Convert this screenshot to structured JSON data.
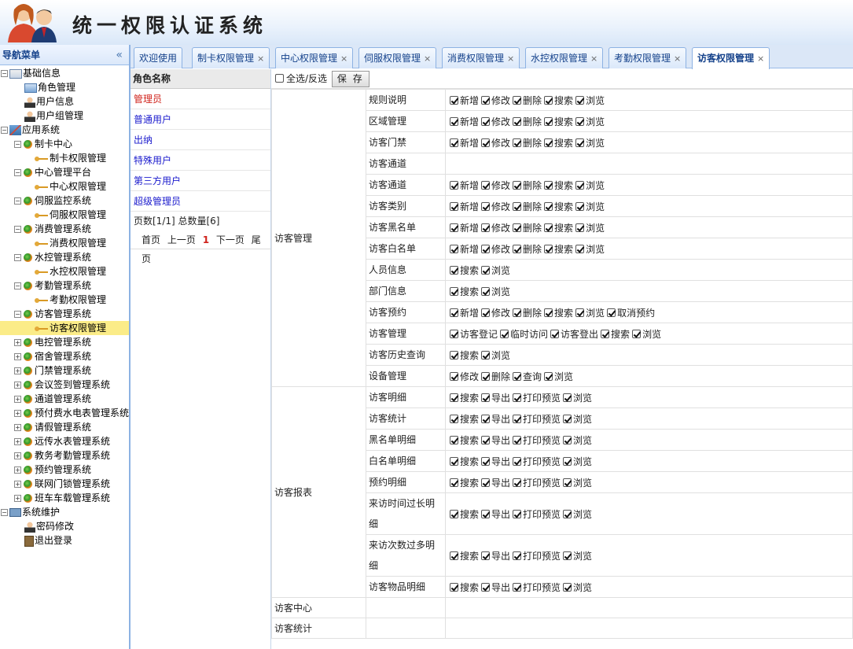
{
  "app": {
    "title": "统一权限认证系统"
  },
  "sidebar": {
    "title": "导航菜单",
    "collapse_glyph": "«",
    "items": [
      {
        "depth": 0,
        "exp": "-",
        "icon": "folder",
        "label": "基础信息"
      },
      {
        "depth": 1,
        "icon": "role",
        "label": "角色管理"
      },
      {
        "depth": 1,
        "icon": "user",
        "label": "用户信息"
      },
      {
        "depth": 1,
        "icon": "user",
        "label": "用户组管理"
      },
      {
        "depth": 0,
        "exp": "-",
        "icon": "house",
        "label": "应用系统"
      },
      {
        "depth": 1,
        "exp": "-",
        "icon": "globe",
        "label": "制卡中心"
      },
      {
        "depth": 2,
        "icon": "key",
        "label": "制卡权限管理"
      },
      {
        "depth": 1,
        "exp": "-",
        "icon": "globe",
        "label": "中心管理平台"
      },
      {
        "depth": 2,
        "icon": "key",
        "label": "中心权限管理"
      },
      {
        "depth": 1,
        "exp": "-",
        "icon": "globe",
        "label": "伺服监控系统"
      },
      {
        "depth": 2,
        "icon": "key",
        "label": "伺服权限管理"
      },
      {
        "depth": 1,
        "exp": "-",
        "icon": "globe",
        "label": "消费管理系统"
      },
      {
        "depth": 2,
        "icon": "key",
        "label": "消费权限管理"
      },
      {
        "depth": 1,
        "exp": "-",
        "icon": "globe",
        "label": "水控管理系统"
      },
      {
        "depth": 2,
        "icon": "key",
        "label": "水控权限管理"
      },
      {
        "depth": 1,
        "exp": "-",
        "icon": "globe",
        "label": "考勤管理系统"
      },
      {
        "depth": 2,
        "icon": "key",
        "label": "考勤权限管理"
      },
      {
        "depth": 1,
        "exp": "-",
        "icon": "globe",
        "label": "访客管理系统"
      },
      {
        "depth": 2,
        "icon": "key",
        "label": "访客权限管理",
        "selected": true
      },
      {
        "depth": 1,
        "exp": "+",
        "icon": "globe",
        "label": "电控管理系统"
      },
      {
        "depth": 1,
        "exp": "+",
        "icon": "globe",
        "label": "宿舍管理系统"
      },
      {
        "depth": 1,
        "exp": "+",
        "icon": "globe",
        "label": "门禁管理系统"
      },
      {
        "depth": 1,
        "exp": "+",
        "icon": "globe",
        "label": "会议签到管理系统"
      },
      {
        "depth": 1,
        "exp": "+",
        "icon": "globe",
        "label": "通道管理系统"
      },
      {
        "depth": 1,
        "exp": "+",
        "icon": "globe",
        "label": "预付费水电表管理系统"
      },
      {
        "depth": 1,
        "exp": "+",
        "icon": "globe",
        "label": "请假管理系统"
      },
      {
        "depth": 1,
        "exp": "+",
        "icon": "globe",
        "label": "远传水表管理系统"
      },
      {
        "depth": 1,
        "exp": "+",
        "icon": "globe",
        "label": "教务考勤管理系统"
      },
      {
        "depth": 1,
        "exp": "+",
        "icon": "globe",
        "label": "预约管理系统"
      },
      {
        "depth": 1,
        "exp": "+",
        "icon": "globe",
        "label": "联网门锁管理系统"
      },
      {
        "depth": 1,
        "exp": "+",
        "icon": "globe",
        "label": "班车车载管理系统"
      },
      {
        "depth": 0,
        "exp": "-",
        "icon": "pc",
        "label": "系统维护"
      },
      {
        "depth": 1,
        "icon": "user",
        "label": "密码修改"
      },
      {
        "depth": 1,
        "icon": "door",
        "label": "退出登录"
      }
    ]
  },
  "tabs": [
    {
      "label": "欢迎使用",
      "closable": false
    },
    {
      "label": "制卡权限管理",
      "closable": true
    },
    {
      "label": "中心权限管理",
      "closable": true
    },
    {
      "label": "伺服权限管理",
      "closable": true
    },
    {
      "label": "消费权限管理",
      "closable": true
    },
    {
      "label": "水控权限管理",
      "closable": true
    },
    {
      "label": "考勤权限管理",
      "closable": true
    },
    {
      "label": "访客权限管理",
      "closable": true,
      "active": true
    }
  ],
  "tab_close_glyph": "×",
  "roles": {
    "header": "角色名称",
    "items": [
      {
        "label": "管理员",
        "selected": true
      },
      {
        "label": "普通用户"
      },
      {
        "label": "出纳"
      },
      {
        "label": "特殊用户"
      },
      {
        "label": "第三方用户"
      },
      {
        "label": "超级管理员"
      }
    ],
    "page_info": "页数[1/1]  总数量[6]",
    "pager": {
      "first": "首页",
      "prev": "上一页",
      "current": "1",
      "next": "下一页",
      "last": "尾页"
    }
  },
  "permissions": {
    "select_all_label": "全选/反选",
    "save_label": "保 存",
    "groups": [
      {
        "name": "访客管理",
        "rows": [
          {
            "name": "规则说明",
            "ops": [
              "新增",
              "修改",
              "删除",
              "搜索",
              "浏览"
            ]
          },
          {
            "name": "区域管理",
            "ops": [
              "新增",
              "修改",
              "删除",
              "搜索",
              "浏览"
            ]
          },
          {
            "name": "访客门禁",
            "ops": [
              "新增",
              "修改",
              "删除",
              "搜索",
              "浏览"
            ]
          },
          {
            "name": "访客通道",
            "ops": []
          },
          {
            "name": "访客通道",
            "ops": [
              "新增",
              "修改",
              "删除",
              "搜索",
              "浏览"
            ]
          },
          {
            "name": "访客类别",
            "ops": [
              "新增",
              "修改",
              "删除",
              "搜索",
              "浏览"
            ]
          },
          {
            "name": "访客黑名单",
            "ops": [
              "新增",
              "修改",
              "删除",
              "搜索",
              "浏览"
            ]
          },
          {
            "name": "访客白名单",
            "ops": [
              "新增",
              "修改",
              "删除",
              "搜索",
              "浏览"
            ]
          },
          {
            "name": "人员信息",
            "ops": [
              "搜索",
              "浏览"
            ]
          },
          {
            "name": "部门信息",
            "ops": [
              "搜索",
              "浏览"
            ]
          },
          {
            "name": "访客预约",
            "ops": [
              "新增",
              "修改",
              "删除",
              "搜索",
              "浏览",
              "取消预约"
            ]
          },
          {
            "name": "访客管理",
            "ops": [
              "访客登记",
              "临时访问",
              "访客登出",
              "搜索",
              "浏览"
            ]
          },
          {
            "name": "访客历史查询",
            "ops": [
              "搜索",
              "浏览"
            ]
          },
          {
            "name": "设备管理",
            "ops": [
              "修改",
              "删除",
              "查询",
              "浏览"
            ]
          }
        ]
      },
      {
        "name": "访客报表",
        "rows": [
          {
            "name": "访客明细",
            "ops": [
              "搜索",
              "导出",
              "打印预览",
              "浏览"
            ]
          },
          {
            "name": "访客统计",
            "ops": [
              "搜索",
              "导出",
              "打印预览",
              "浏览"
            ]
          },
          {
            "name": "黑名单明细",
            "ops": [
              "搜索",
              "导出",
              "打印预览",
              "浏览"
            ]
          },
          {
            "name": "白名单明细",
            "ops": [
              "搜索",
              "导出",
              "打印预览",
              "浏览"
            ]
          },
          {
            "name": "预约明细",
            "ops": [
              "搜索",
              "导出",
              "打印预览",
              "浏览"
            ]
          },
          {
            "name": "来访时间过长明细",
            "ops": [
              "搜索",
              "导出",
              "打印预览",
              "浏览"
            ]
          },
          {
            "name": "来访次数过多明细",
            "ops": [
              "搜索",
              "导出",
              "打印预览",
              "浏览"
            ]
          },
          {
            "name": "访客物品明细",
            "ops": [
              "搜索",
              "导出",
              "打印预览",
              "浏览"
            ]
          }
        ]
      },
      {
        "name": "访客中心",
        "rows": [
          {
            "name": "",
            "ops": []
          }
        ]
      },
      {
        "name": "访客统计",
        "rows": [
          {
            "name": "",
            "ops": []
          }
        ]
      }
    ]
  }
}
